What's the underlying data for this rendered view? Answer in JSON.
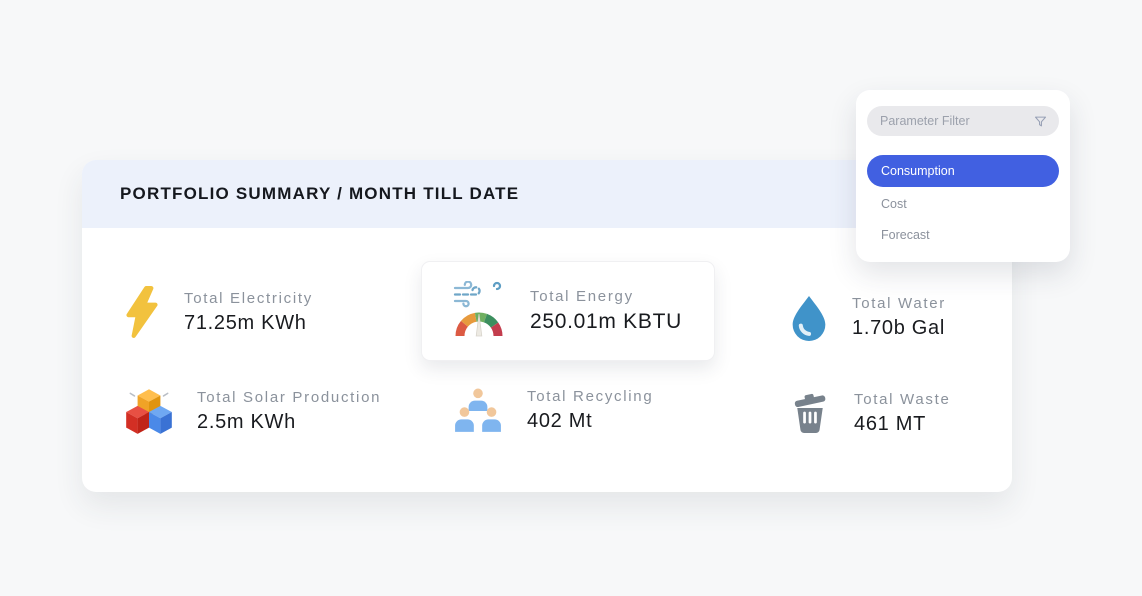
{
  "summary_card": {
    "title": "PORTFOLIO SUMMARY / MONTH TILL DATE",
    "metrics": [
      {
        "id": "electricity",
        "icon": "lightning-bolt-icon",
        "label": "Total Electricity",
        "value": "71.25m KWh"
      },
      {
        "id": "energy",
        "icon": "air-quality-gauge-icon",
        "label": "Total Energy",
        "value": "250.01m KBTU",
        "highlighted": true
      },
      {
        "id": "water",
        "icon": "water-drop-icon",
        "label": "Total Water",
        "value": "1.70b Gal"
      },
      {
        "id": "solar",
        "icon": "cubes-icon",
        "label": "Total Solar Production",
        "value": "2.5m KWh"
      },
      {
        "id": "recycling",
        "icon": "people-icon",
        "label": "Total Recycling",
        "value": "402 Mt"
      },
      {
        "id": "waste",
        "icon": "trash-icon",
        "label": "Total Waste",
        "value": "461 MT"
      }
    ]
  },
  "filter_panel": {
    "input_placeholder": "Parameter Filter",
    "filter_icon": "funnel-icon",
    "options": [
      {
        "label": "Consumption",
        "selected": true
      },
      {
        "label": "Cost",
        "selected": false
      },
      {
        "label": "Forecast",
        "selected": false
      }
    ]
  },
  "colors": {
    "accent_blue": "#4160e1",
    "header_bg": "#ecf1fb",
    "page_bg": "#f7f8f9",
    "bolt_yellow": "#f2c23e",
    "water_blue": "#4093c9",
    "trash_gray": "#78828c",
    "label_gray": "#8b929c"
  }
}
